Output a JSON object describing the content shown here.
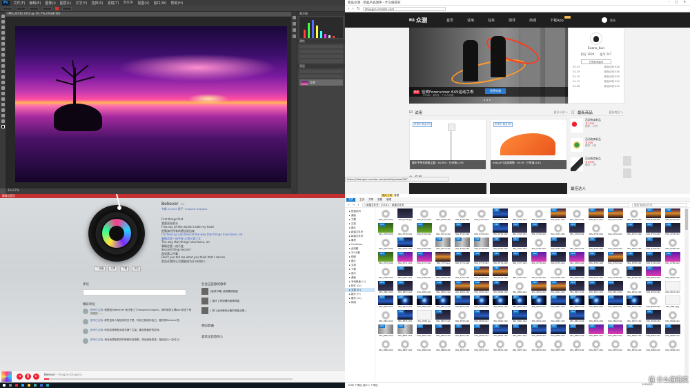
{
  "photoshop": {
    "logo": "Ps",
    "menu": [
      "文件(F)",
      "编辑(E)",
      "图像(I)",
      "图层(L)",
      "文字(Y)",
      "选择(S)",
      "滤镜(T)",
      "3D(D)",
      "视图(V)",
      "窗口(W)",
      "帮助(H)"
    ],
    "doc_tab": "IMG_8731.CR2 @ 16.7% (RGB/16)",
    "zoom_status": "16.67%",
    "panels": {
      "histogram": "直方图",
      "properties": "属性",
      "layers": "图层",
      "layer_name": "背景"
    }
  },
  "browser": {
    "window_title": "新品众测 - 新品产品测评 - 什么值得买",
    "url": "zhongce.smzdm.com",
    "brand": "众测",
    "brand_small": "新品",
    "nav": [
      "首页",
      "试用",
      "任务",
      "测评",
      "商城",
      "下载App"
    ],
    "nav_new_badge": "NEW",
    "login": "登录",
    "banner": {
      "badge": "晒单",
      "caption": "佳明Forerunner 645运动手表",
      "subcaption": "¥3380 · 剩5件 · 775人申请",
      "button": "免费申请"
    },
    "profile": {
      "name": "Evans_Sun",
      "stats": [
        "积分 1039",
        "金币 247"
      ],
      "button": "已签到领金币",
      "lines": [
        [
          "05-03",
          "新品众测·XXX"
        ],
        [
          "04-29",
          "新品众测·XXX"
        ],
        [
          "04-19",
          "新品众测·XXX"
        ],
        [
          "04-13",
          "新品众测·XXX"
        ],
        [
          "04-06",
          "新品众测·XXX"
        ]
      ]
    },
    "trial": {
      "title": "试用",
      "more": "更多众测 >",
      "cards": [
        {
          "label": "申请中·剩余5件",
          "caption": "顺丰手持无线吸尘器 · ¥2390 · 已申请1276"
        },
        {
          "label": "申请中·剩余5件",
          "caption": "AMAZFIT运动跑鞋 · ¥479 · 已申请2135"
        }
      ]
    },
    "newest": {
      "title": "最新商品",
      "more": "更多商品 >",
      "items": [
        {
          "name": "活动热卖新品",
          "price": "￥1199",
          "count": "剩余: 19件"
        },
        {
          "name": "活动热卖新品",
          "price": "￥799",
          "count": "剩余: 9件"
        },
        {
          "name": "活动热卖新品",
          "price": "￥1999",
          "count": "剩余: 7件"
        }
      ]
    },
    "task_title": "任务",
    "status_url": "https://zhongce.smzdm.com/activity/view/207",
    "footer_hint": "最佳达人"
  },
  "music": {
    "app_title": "网易云音乐",
    "song": "Believer",
    "song_tag": "MV",
    "album": "专辑: Evolve    歌手: Imagine Dragons",
    "lyrics": [
      "First things first",
      "我要说在前头",
      "I'ma say all the words inside my head",
      "把脑海中所有的想法说出来",
      "I'm fired up and tired of the way that things have been, oh",
      "事情总是一成不变 让我火冒三丈",
      "The way that things have been, oh",
      "事情总是一成不变",
      "Second thing second",
      "再说第二件事",
      "Don't you tell me what you think that I can be",
      "别告诉我你认为我能成为什么样的人"
    ],
    "highlight_index": 4,
    "actions": [
      "♡ 收藏",
      "分享",
      "下载",
      "评论"
    ],
    "comment_header": "评论",
    "hot_comments_title": "精彩评论",
    "comments": [
      {
        "user": "账号已注销",
        "text": "就是因为Believer 我才爱上了Imagine Dragons，那时候的主唱Dan讲述了他的经历……"
      },
      {
        "user": "账号已注销",
        "text": "那些没有人相信你的日子里，你自己相信你自己，做你的Believer吧。"
      },
      {
        "user": "账号已注销",
        "text": "听到这首歌就浑身充满了力量，痛苦是最好的老师。"
      },
      {
        "user": "账号已注销",
        "text": "每当我想放弃的时候就听这首歌，然后继续前进，相信自己一定可以！"
      }
    ],
    "similar_title": "包含这首歌的歌单",
    "similar": [
      {
        "title": "[欧美节奏] 欧美震撼燃曲"
      },
      {
        "title": "[ 循环 ] 燃到爆的欧美神曲"
      },
      {
        "title": "[ 燃 ] 运动健身必备的燃曲合集 ]"
      }
    ],
    "similar_songs_title": "相似歌曲",
    "users_title": "喜欢这首歌的人",
    "footer_title": "Believer",
    "footer_artist": "Imagine Dragons",
    "progress_fraction": 0.02
  },
  "explorer": {
    "ribbon_tool": "图片工具",
    "ribbon_title": "管理",
    "tabs": [
      "文件",
      "主页",
      "共享",
      "查看",
      "管理"
    ],
    "path": "« 新建文件夹 › 2018.4 › 新建文件夹",
    "search_placeholder": "搜索\"新建文件夹\"",
    "tree": [
      {
        "label": "快速访问",
        "sel": false
      },
      {
        "label": "桌面",
        "sel": false
      },
      {
        "label": "下载",
        "sel": false
      },
      {
        "label": "文档",
        "sel": false
      },
      {
        "label": "图片",
        "sel": false
      },
      {
        "label": "新建文件夹",
        "sel": false
      },
      {
        "label": "新建文件夹",
        "sel": false
      },
      {
        "label": "素材",
        "sel": false
      },
      {
        "label": "OneDrive",
        "sel": false
      },
      {
        "label": "此电脑",
        "sel": false
      },
      {
        "label": "3D 对象",
        "sel": false
      },
      {
        "label": "视频",
        "sel": false
      },
      {
        "label": "图片",
        "sel": false
      },
      {
        "label": "文档",
        "sel": false
      },
      {
        "label": "下载",
        "sel": false
      },
      {
        "label": "音乐",
        "sel": false
      },
      {
        "label": "桌面",
        "sel": false
      },
      {
        "label": "本地磁盘 (C:)",
        "sel": false
      },
      {
        "label": "软件 (D:)",
        "sel": false
      },
      {
        "label": "文档 (E:)",
        "sel": true
      },
      {
        "label": "娱乐 (F:)",
        "sel": false
      },
      {
        "label": "备份 (G:)",
        "sel": false
      },
      {
        "label": "网络",
        "sel": false
      }
    ],
    "files": [
      {
        "n": "IMG_8723.CR2",
        "k": 0,
        "r": false
      },
      {
        "n": "IMG_8723.jpg",
        "k": 1,
        "r": false
      },
      {
        "n": "IMG_8724.CR2",
        "k": 0,
        "r": false
      },
      {
        "n": "IMG_8725.CR2",
        "k": 0,
        "r": false
      },
      {
        "n": "IMG_8726.CR2",
        "k": 0,
        "r": false
      },
      {
        "n": "IMG_8727.CR2",
        "k": 0,
        "r": false
      },
      {
        "n": "IMG_8728.CR2",
        "k": 3,
        "r": true
      },
      {
        "n": "IMG_8729.CR2",
        "k": 0,
        "r": false
      },
      {
        "n": "IMG_8730.CR2",
        "k": 0,
        "r": false
      },
      {
        "n": "IMG_8731.CR2",
        "k": 4,
        "r": true
      },
      {
        "n": "IMG_8732.CR2",
        "k": 0,
        "r": false
      },
      {
        "n": "IMG_8733.CR2",
        "k": 4,
        "r": true
      },
      {
        "n": "IMG_8734.CR2",
        "k": 4,
        "r": true
      },
      {
        "n": "IMG_8735.CR2",
        "k": 0,
        "r": false
      },
      {
        "n": "IMG_8736.CR2",
        "k": 4,
        "r": true
      },
      {
        "n": "IMG_8737.CR2",
        "k": 4,
        "r": true
      },
      {
        "n": "IMG_8738.CR2",
        "k": 2,
        "r": true
      },
      {
        "n": "IMG_8739.CR2",
        "k": 0,
        "r": false
      },
      {
        "n": "IMG_8740.CR2",
        "k": 2,
        "r": true
      },
      {
        "n": "IMG_8741.CR2",
        "k": 0,
        "r": false
      },
      {
        "n": "IMG_8742.CR2",
        "k": 1,
        "r": true
      },
      {
        "n": "IMG_8743.CR2",
        "k": 0,
        "r": false
      },
      {
        "n": "IMG_8744.CR2",
        "k": 3,
        "r": true
      },
      {
        "n": "IMG_8745.CR2",
        "k": 1,
        "r": true
      },
      {
        "n": "IMG_8746.CR2",
        "k": 1,
        "r": true
      },
      {
        "n": "IMG_8747.CR2",
        "k": 0,
        "r": false
      },
      {
        "n": "IMG_8748.CR2",
        "k": 1,
        "r": true
      },
      {
        "n": "IMG_8749.CR2",
        "k": 0,
        "r": false
      },
      {
        "n": "IMG_8750.CR2",
        "k": 0,
        "r": false
      },
      {
        "n": "IMG_8751.CR2",
        "k": 1,
        "r": true
      },
      {
        "n": "IMG_8752.CR2",
        "k": 1,
        "r": true
      },
      {
        "n": "IMG_8753.CR2",
        "k": 1,
        "r": true
      },
      {
        "n": "IMG_8754.CR2",
        "k": 0,
        "r": false
      },
      {
        "n": "IMG_8755.CR2",
        "k": 3,
        "r": true
      },
      {
        "n": "IMG_8756.CR2",
        "k": 0,
        "r": false
      },
      {
        "n": "IMG_8757.CR2",
        "k": 5,
        "r": true
      },
      {
        "n": "IMG_8758.CR2",
        "k": 5,
        "r": true
      },
      {
        "n": "IMG_8759.CR2",
        "k": 5,
        "r": true
      },
      {
        "n": "IMG_8760.CR2",
        "k": 1,
        "r": true
      },
      {
        "n": "IMG_8761.CR2",
        "k": 1,
        "r": true
      },
      {
        "n": "IMG_8762.CR2",
        "k": 0,
        "r": false
      },
      {
        "n": "IMG_8763.CR2",
        "k": 1,
        "r": true
      },
      {
        "n": "IMG_8764.CR2",
        "k": 0,
        "r": false
      },
      {
        "n": "IMG_8765.CR2",
        "k": 1,
        "r": true
      },
      {
        "n": "IMG_8766.CR2",
        "k": 0,
        "r": false
      },
      {
        "n": "IMG_8767.CR2",
        "k": 0,
        "r": false
      },
      {
        "n": "IMG_8768.CR2",
        "k": 1,
        "r": true
      },
      {
        "n": "IMG_8769.CR2",
        "k": 0,
        "r": false
      },
      {
        "n": "IMG_8770.CR2",
        "k": 2,
        "r": true
      },
      {
        "n": "IMG_8771.CR2",
        "k": 6,
        "r": true
      },
      {
        "n": "IMG_8772.CR2",
        "k": 6,
        "r": true
      },
      {
        "n": "IMG_8773.jpg",
        "k": 4,
        "r": false
      },
      {
        "n": "IMG_8774.CR2",
        "k": 1,
        "r": true
      },
      {
        "n": "IMG_8775.CR2",
        "k": 1,
        "r": true
      },
      {
        "n": "IMG_8776.CR2",
        "k": 1,
        "r": true
      },
      {
        "n": "IMG_8777.CR2",
        "k": 1,
        "r": true
      },
      {
        "n": "IMG_8778.CR2",
        "k": 6,
        "r": true
      },
      {
        "n": "IMG_8779.CR2",
        "k": 1,
        "r": true
      },
      {
        "n": "IMG_8780.CR2",
        "k": 6,
        "r": true
      },
      {
        "n": "IMG_8781.CR2",
        "k": 1,
        "r": true
      },
      {
        "n": "IMG_8782.CR2",
        "k": 4,
        "r": true
      },
      {
        "n": "IMG_8783.CR2",
        "k": 1,
        "r": true
      },
      {
        "n": "IMG_8784.CR2",
        "k": 1,
        "r": true
      },
      {
        "n": "IMG_8785.CR2",
        "k": 6,
        "r": true
      },
      {
        "n": "IMG_8786.CR2",
        "k": 0,
        "r": false
      },
      {
        "n": "IMG_8787.CR2",
        "k": 1,
        "r": true
      },
      {
        "n": "IMG_8788.CR2",
        "k": 0,
        "r": false
      },
      {
        "n": "IMG_8789.CR2",
        "k": 1,
        "r": true
      },
      {
        "n": "IMG_8790.CR2",
        "k": 0,
        "r": false
      },
      {
        "n": "IMG_8791.CR2",
        "k": 4,
        "r": true
      },
      {
        "n": "IMG_8792.CR2",
        "k": 4,
        "r": true
      },
      {
        "n": "IMG_8793.CR2",
        "k": 0,
        "r": false
      },
      {
        "n": "IMG_8794.CR2",
        "k": 0,
        "r": false
      },
      {
        "n": "IMG_8795.CR2",
        "k": 0,
        "r": false
      },
      {
        "n": "IMG_8796.CR2",
        "k": 1,
        "r": true
      },
      {
        "n": "IMG_8797.CR2",
        "k": 1,
        "r": true
      },
      {
        "n": "IMG_8798.CR2",
        "k": 0,
        "r": false
      },
      {
        "n": "IMG_8799.CR2",
        "k": 1,
        "r": true
      },
      {
        "n": "IMG_8800.CR2",
        "k": 6,
        "r": true
      },
      {
        "n": "IMG_8801.CR2",
        "k": 0,
        "r": false
      },
      {
        "n": "IMG_8802.CR2",
        "k": 1,
        "r": true
      },
      {
        "n": "IMG_8803.CR2",
        "k": 1,
        "r": true
      },
      {
        "n": "IMG_8804.CR2",
        "k": 0,
        "r": false
      },
      {
        "n": "IMG_8805.CR2",
        "k": 1,
        "r": true
      },
      {
        "n": "IMG_8806.CR2",
        "k": 4,
        "r": true
      },
      {
        "n": "IMG_8807.CR2",
        "k": 4,
        "r": true
      },
      {
        "n": "IMG_8808.CR2",
        "k": 1,
        "r": true
      },
      {
        "n": "IMG_8809.CR2",
        "k": 0,
        "r": false
      },
      {
        "n": "IMG_8810.CR2",
        "k": 4,
        "r": true
      },
      {
        "n": "IMG_8811.CR2",
        "k": 4,
        "r": true
      },
      {
        "n": "IMG_8812.CR2",
        "k": 1,
        "r": true
      },
      {
        "n": "IMG_8813.CR2",
        "k": 1,
        "r": true
      },
      {
        "n": "IMG_8814.CR2",
        "k": 1,
        "r": true
      },
      {
        "n": "IMG_8815.CR2",
        "k": 0,
        "r": false
      },
      {
        "n": "IMG_8816.CR2",
        "k": 1,
        "r": true
      },
      {
        "n": "IMG_8817.CR2",
        "k": 8,
        "r": false
      },
      {
        "n": "IMG_8818.CR2",
        "k": 3,
        "r": true
      },
      {
        "n": "IMG_8819.CR2",
        "k": 7,
        "r": true
      },
      {
        "n": "IMG_8820.CR2",
        "k": 7,
        "r": true
      },
      {
        "n": "IMG_8821.CR2",
        "k": 7,
        "r": true
      },
      {
        "n": "IMG_8822.CR2",
        "k": 3,
        "r": true
      },
      {
        "n": "IMG_8823.CR2",
        "k": 7,
        "r": true
      },
      {
        "n": "IMG_8824.CR2",
        "k": 7,
        "r": true
      },
      {
        "n": "IMG_8825.CR2",
        "k": 7,
        "r": true
      },
      {
        "n": "IMG_8826.CR2",
        "k": 7,
        "r": true
      },
      {
        "n": "IMG_8827.CR2",
        "k": 3,
        "r": true
      },
      {
        "n": "IMG_8828.CR2",
        "k": 7,
        "r": true
      },
      {
        "n": "IMG_8829.CR2",
        "k": 7,
        "r": true
      },
      {
        "n": "IMG_8830.CR2",
        "k": 3,
        "r": true
      },
      {
        "n": "IMG_8831.CR2",
        "k": 7,
        "r": true
      },
      {
        "n": "IMG_8832.CR2",
        "k": 0,
        "r": false
      },
      {
        "n": "IMG_8833.jpg",
        "k": 8,
        "r": false
      },
      {
        "n": "IMG_8834.CR2",
        "k": 0,
        "r": false
      },
      {
        "n": "IMG_8835.CR2",
        "k": 3,
        "r": true
      },
      {
        "n": "IMG_8836.jpg",
        "k": 8,
        "r": false
      },
      {
        "n": "IMG_8837.CR2",
        "k": 1,
        "r": true
      },
      {
        "n": "IMG_8838.CR2",
        "k": 0,
        "r": false
      },
      {
        "n": "IMG_8839.CR2",
        "k": 3,
        "r": true
      },
      {
        "n": "IMG_8840.CR2",
        "k": 0,
        "r": false
      },
      {
        "n": "IMG_8841.CR2",
        "k": 3,
        "r": true
      },
      {
        "n": "IMG_8842.CR2",
        "k": 0,
        "r": false
      },
      {
        "n": "IMG_8843.CR2",
        "k": 0,
        "r": false
      },
      {
        "n": "IMG_8844.CR2",
        "k": 3,
        "r": true
      },
      {
        "n": "IMG_8845.CR2",
        "k": 0,
        "r": false
      },
      {
        "n": "IMG_8846.CR2",
        "k": 0,
        "r": false
      },
      {
        "n": "IMG_8847.CR2",
        "k": 0,
        "r": false
      },
      {
        "n": "IMG_8848.CR2",
        "k": 1,
        "r": true
      },
      {
        "n": "IMG_8849.CR2",
        "k": 0,
        "r": false
      },
      {
        "n": "IMG_8850.CR2",
        "k": 5,
        "r": true
      },
      {
        "n": "IMG_8851.CR2",
        "k": 5,
        "r": true
      },
      {
        "n": "IMG_8852.CR2",
        "k": 1,
        "r": true
      },
      {
        "n": "IMG_8853.CR2",
        "k": 1,
        "r": true
      },
      {
        "n": "IMG_8854.CR2",
        "k": 1,
        "r": true
      },
      {
        "n": "IMG_8855.CR2",
        "k": 1,
        "r": true
      },
      {
        "n": "IMG_8856.CR2",
        "k": 3,
        "r": true
      },
      {
        "n": "IMG_8857.CR2",
        "k": 1,
        "r": true
      },
      {
        "n": "IMG_8858.CR2",
        "k": 3,
        "r": true
      },
      {
        "n": "IMG_8859.CR2",
        "k": 3,
        "r": true
      },
      {
        "n": "IMG_8860.CR2",
        "k": 1,
        "r": true
      },
      {
        "n": "IMG_8861.CR2",
        "k": 6,
        "r": true
      },
      {
        "n": "IMG_8862.CR2",
        "k": 6,
        "r": true
      },
      {
        "n": "IMG_8863.CR2",
        "k": 1,
        "r": true
      },
      {
        "n": "IMG_8864.CR2",
        "k": 1,
        "r": true
      },
      {
        "n": "IMG_8865.CR2",
        "k": 1,
        "r": true
      },
      {
        "n": "IMG_8866.CR2",
        "k": 0,
        "r": false
      },
      {
        "n": "IMG_8867.CR2",
        "k": 0,
        "r": false
      },
      {
        "n": "IMG_8868.CR2",
        "k": 0,
        "r": false
      },
      {
        "n": "IMG_8869.CR2",
        "k": 0,
        "r": false
      },
      {
        "n": "IMG_8870.CR2",
        "k": 0,
        "r": false
      },
      {
        "n": "IMG_8871.CR2",
        "k": 0,
        "r": false
      },
      {
        "n": "IMG_8872.CR2",
        "k": 0,
        "r": false
      },
      {
        "n": "IMG_8873.CR2",
        "k": 0,
        "r": false
      },
      {
        "n": "IMG_8874.CR2",
        "k": 0,
        "r": false
      },
      {
        "n": "IMG_8875.CR2",
        "k": 0,
        "r": false
      },
      {
        "n": "IMG_8876.CR2",
        "k": 0,
        "r": false
      },
      {
        "n": "IMG_8877.CR2",
        "k": 0,
        "r": false
      },
      {
        "n": "IMG_8878.CR2",
        "k": 0,
        "r": false
      },
      {
        "n": "IMG_8879.CR2",
        "k": 0,
        "r": false
      },
      {
        "n": "IMG_8880.CR2",
        "k": 0,
        "r": false
      },
      {
        "n": "IMG_8881.CR2",
        "k": 0,
        "r": false
      }
    ],
    "status": "1096 个项目    选中 1 个项目",
    "clock": "2018/5/5",
    "watermark": "值 什么值得买"
  }
}
